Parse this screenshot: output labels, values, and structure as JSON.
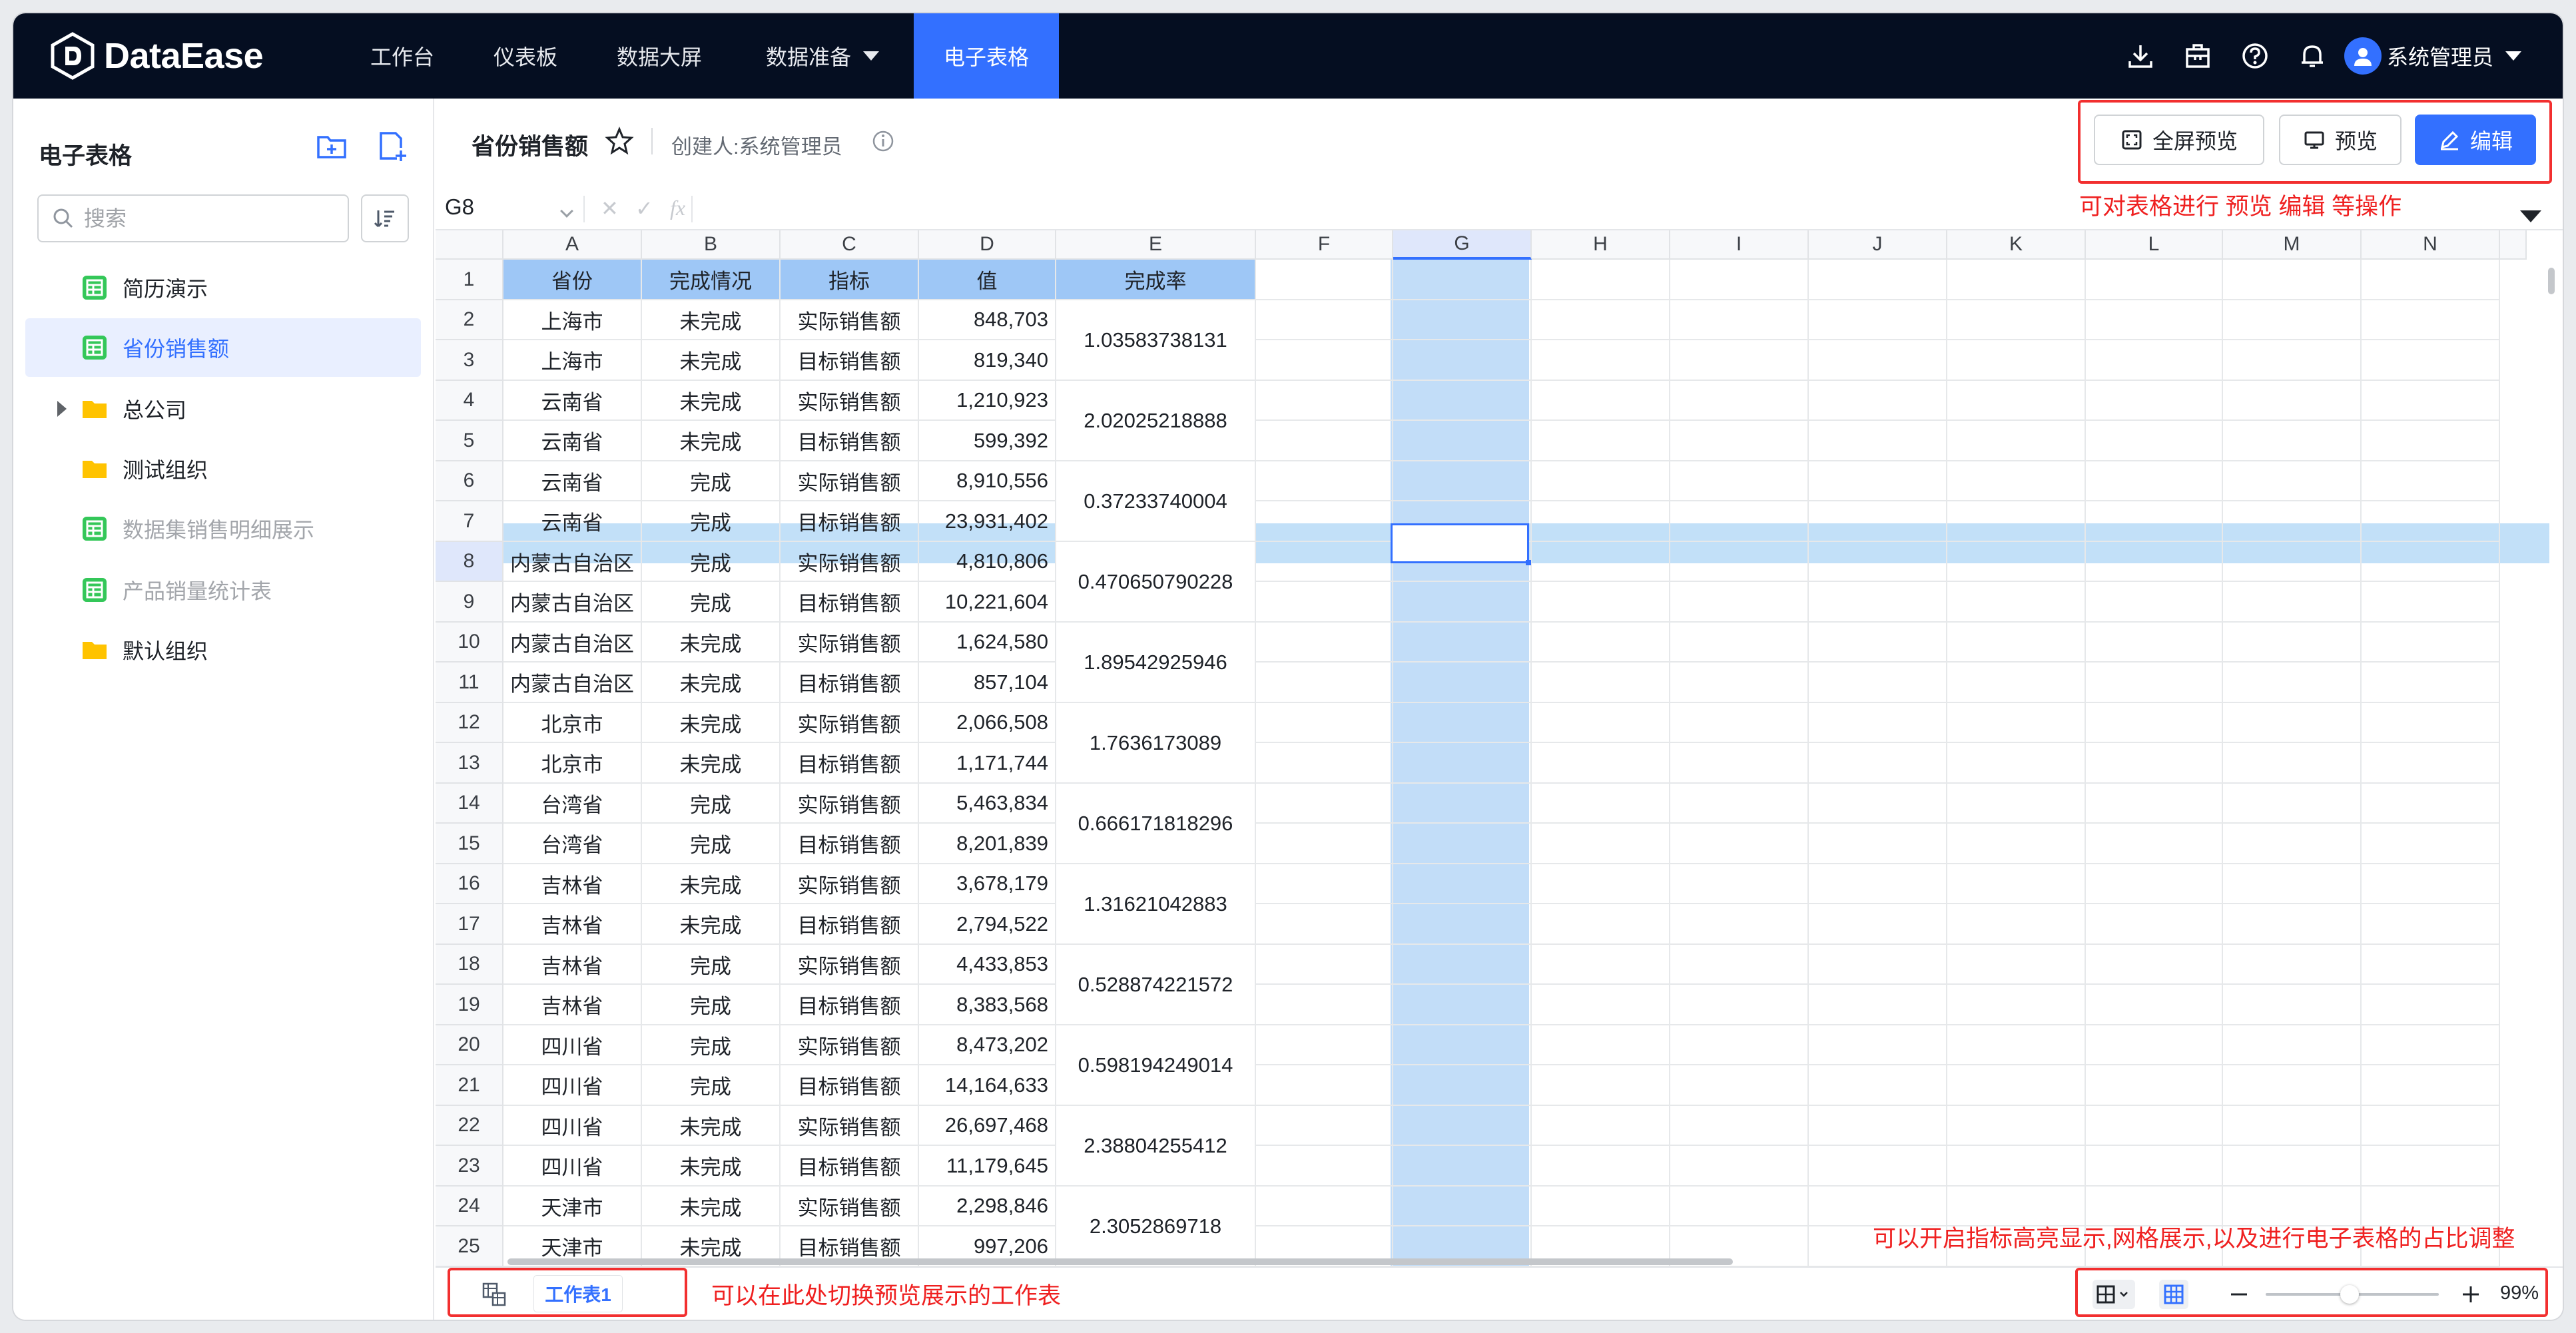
{
  "brand": {
    "name": "DataEase"
  },
  "nav": {
    "items": [
      {
        "label": "工作台"
      },
      {
        "label": "仪表板"
      },
      {
        "label": "数据大屏"
      },
      {
        "label": "数据准备"
      },
      {
        "label": "电子表格"
      }
    ],
    "active": "电子表格",
    "user": "系统管理员",
    "icons": [
      "download-icon",
      "briefcase-icon",
      "help-icon",
      "bell-icon",
      "avatar-icon"
    ]
  },
  "sidebar": {
    "title": "电子表格",
    "search_placeholder": "搜索",
    "items": [
      {
        "label": "简历演示",
        "icon": "sheet-icon"
      },
      {
        "label": "省份销售额",
        "icon": "sheet-icon",
        "selected": true
      },
      {
        "label": "总公司",
        "icon": "folder-icon",
        "expandable": true
      },
      {
        "label": "测试组织",
        "icon": "folder-icon"
      },
      {
        "label": "数据集销售明细展示",
        "icon": "sheet-icon",
        "disabled": true
      },
      {
        "label": "产品销量统计表",
        "icon": "sheet-icon",
        "disabled": true
      },
      {
        "label": "默认组织",
        "icon": "folder-icon"
      }
    ]
  },
  "header": {
    "title": "省份销售额",
    "creator": "创建人:系统管理员",
    "buttons": {
      "fullscreen": "全屏预览",
      "preview": "预览",
      "edit": "编辑"
    }
  },
  "formula_bar": {
    "cell_ref": "G8",
    "fx": "fx"
  },
  "annotations": {
    "top": "可对表格进行 预览 编辑 等操作",
    "bottom_right": "可以开启指标高亮显示,网格展示,以及进行电子表格的占比调整",
    "bottom_left": "可以在此处切换预览展示的工作表"
  },
  "sheet": {
    "columns": [
      "A",
      "B",
      "C",
      "D",
      "E",
      "F",
      "G",
      "H",
      "I",
      "J",
      "K",
      "L",
      "M",
      "N"
    ],
    "selected_col": "G",
    "selected_row": 8,
    "header": [
      "省份",
      "完成情况",
      "指标",
      "值",
      "完成率"
    ],
    "rows": [
      [
        "上海市",
        "未完成",
        "实际销售额",
        "848,703"
      ],
      [
        "上海市",
        "未完成",
        "目标销售额",
        "819,340"
      ],
      [
        "云南省",
        "未完成",
        "实际销售额",
        "1,210,923"
      ],
      [
        "云南省",
        "未完成",
        "目标销售额",
        "599,392"
      ],
      [
        "云南省",
        "完成",
        "实际销售额",
        "8,910,556"
      ],
      [
        "云南省",
        "完成",
        "目标销售额",
        "23,931,402"
      ],
      [
        "内蒙古自治区",
        "完成",
        "实际销售额",
        "4,810,806"
      ],
      [
        "内蒙古自治区",
        "完成",
        "目标销售额",
        "10,221,604"
      ],
      [
        "内蒙古自治区",
        "未完成",
        "实际销售额",
        "1,624,580"
      ],
      [
        "内蒙古自治区",
        "未完成",
        "目标销售额",
        "857,104"
      ],
      [
        "北京市",
        "未完成",
        "实际销售额",
        "2,066,508"
      ],
      [
        "北京市",
        "未完成",
        "目标销售额",
        "1,171,744"
      ],
      [
        "台湾省",
        "完成",
        "实际销售额",
        "5,463,834"
      ],
      [
        "台湾省",
        "完成",
        "目标销售额",
        "8,201,839"
      ],
      [
        "吉林省",
        "未完成",
        "实际销售额",
        "3,678,179"
      ],
      [
        "吉林省",
        "未完成",
        "目标销售额",
        "2,794,522"
      ],
      [
        "吉林省",
        "完成",
        "实际销售额",
        "4,433,853"
      ],
      [
        "吉林省",
        "完成",
        "目标销售额",
        "8,383,568"
      ],
      [
        "四川省",
        "完成",
        "实际销售额",
        "8,473,202"
      ],
      [
        "四川省",
        "完成",
        "目标销售额",
        "14,164,633"
      ],
      [
        "四川省",
        "未完成",
        "实际销售额",
        "26,697,468"
      ],
      [
        "四川省",
        "未完成",
        "目标销售额",
        "11,179,645"
      ],
      [
        "天津市",
        "未完成",
        "实际销售额",
        "2,298,846"
      ],
      [
        "天津市",
        "未完成",
        "目标销售额",
        "997,206"
      ]
    ],
    "rates": [
      "1.03583738131",
      "2.02025218888",
      "0.37233740004",
      "0.470650790228",
      "1.89542925946",
      "1.7636173089",
      "0.666171818296",
      "1.31621042883",
      "0.528874221572",
      "0.598194249014",
      "2.38804255412",
      "2.3052869718"
    ]
  },
  "bottom": {
    "sheet_tab": "工作表1",
    "zoom": "99%"
  },
  "colors": {
    "accent": "#3370ff",
    "nav_bg": "#050e21",
    "header_fill": "#9ec7f6",
    "selection": "#c2ddf8",
    "annotation": "#f22f2f"
  }
}
